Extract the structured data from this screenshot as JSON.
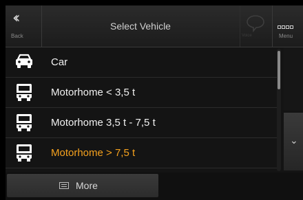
{
  "header": {
    "back_label": "Back",
    "title": "Select Vehicle",
    "menu_label": "Menu",
    "voice_label": "Voice"
  },
  "vehicles": [
    {
      "label": "Car",
      "icon": "car-icon",
      "selected": false
    },
    {
      "label": "Motorhome < 3,5 t",
      "icon": "motorhome-icon",
      "selected": false
    },
    {
      "label": "Motorhome 3,5 t - 7,5 t",
      "icon": "motorhome-icon",
      "selected": false
    },
    {
      "label": "Motorhome > 7,5 t",
      "icon": "motorhome-icon",
      "selected": true
    }
  ],
  "bottom": {
    "more_label": "More"
  },
  "colors": {
    "selected": "#f6a21e",
    "background": "#141414",
    "text": "#f2f2f2"
  }
}
